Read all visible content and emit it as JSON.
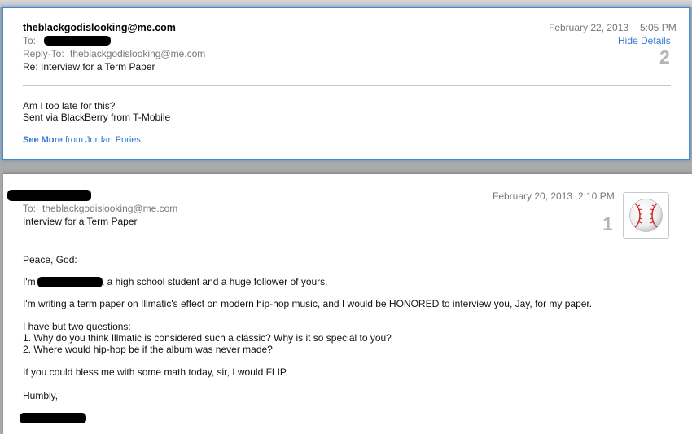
{
  "message_2": {
    "from": "theblackgodislooking@me.com",
    "to_label": "To:",
    "reply_to_label": "Reply-To:",
    "reply_to_value": "theblackgodislooking@me.com",
    "subject": "Re: Interview for a Term Paper",
    "date": "February 22, 2013",
    "time": "5:05 PM",
    "hide_details": "Hide Details",
    "count": "2",
    "body_lines": [
      "Am I too late for this?",
      "Sent via BlackBerry from T-Mobile"
    ],
    "see_more_label": "See More",
    "see_more_from": "from Jordan Pories"
  },
  "message_1": {
    "to_label": "To:",
    "to_value": "theblackgodislooking@me.com",
    "subject": "Interview for a Term Paper",
    "date": "February 20, 2013",
    "time": "2:10 PM",
    "count": "1",
    "avatar_icon": "baseball-icon",
    "greeting": "Peace, God:",
    "intro_prefix": "I'm",
    "intro_suffix": ", a high school student and a huge follower of yours.",
    "paragraph_2": "I'm writing a term paper on Illmatic's effect on modern hip-hop music, and I would be HONORED to interview you, Jay, for my paper.",
    "questions_intro": "I have but two questions:",
    "question_1": "1. Why do you think Illmatic is considered such a classic? Why is it so special to you?",
    "question_2": "2. Where would hip-hop be if the album was never made?",
    "closing_line": "If you could bless me with some math today, sir, I would FLIP.",
    "sign_off": "Humbly,"
  },
  "colors": {
    "accent": "#3477d0",
    "selected_border": "#3e8ad6",
    "background": "#a9aaab",
    "redaction": "#000000"
  }
}
